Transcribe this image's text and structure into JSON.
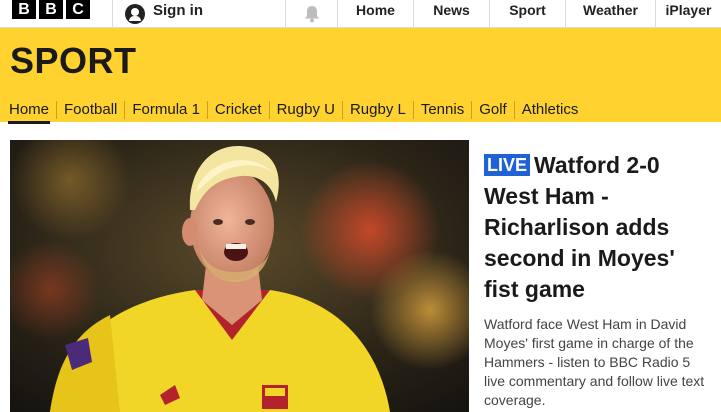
{
  "global_nav": {
    "logo_letters": [
      "B",
      "B",
      "C"
    ],
    "signin_label": "Sign in",
    "links": [
      "Home",
      "News",
      "Sport",
      "Weather",
      "iPlayer"
    ]
  },
  "sport_header": {
    "title": "SPORT",
    "nav": [
      "Home",
      "Football",
      "Formula 1",
      "Cricket",
      "Rugby U",
      "Rugby L",
      "Tennis",
      "Golf",
      "Athletics"
    ],
    "active_index": 0
  },
  "lead_story": {
    "live_badge": "LIVE",
    "headline": "Watford 2-0 West Ham - Richarlison adds second in Moyes' fist game",
    "summary": "Watford face West Ham in David Moyes' first game in charge of the Hammers - listen to BBC Radio 5 live commentary and follow live text coverage."
  },
  "colors": {
    "sport_yellow": "#ffd230",
    "live_blue": "#1e62d6"
  }
}
